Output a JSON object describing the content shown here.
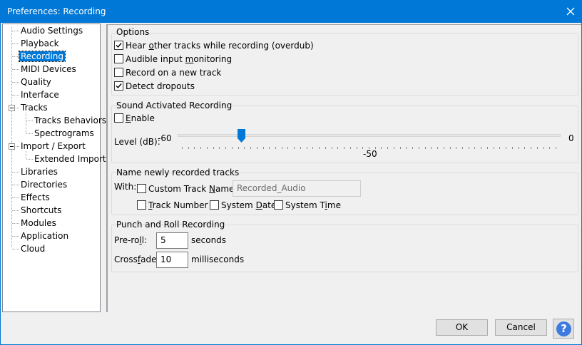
{
  "window": {
    "title": "Preferences: Recording"
  },
  "tree": {
    "items": [
      {
        "label": "Audio Settings"
      },
      {
        "label": "Playback"
      },
      {
        "label": "Recording"
      },
      {
        "label": "MIDI Devices"
      },
      {
        "label": "Quality"
      },
      {
        "label": "Interface"
      },
      {
        "label": "Tracks"
      },
      {
        "label": "Tracks Behaviors"
      },
      {
        "label": "Spectrograms"
      },
      {
        "label": "Import / Export"
      },
      {
        "label": "Extended Import"
      },
      {
        "label": "Libraries"
      },
      {
        "label": "Directories"
      },
      {
        "label": "Effects"
      },
      {
        "label": "Shortcuts"
      },
      {
        "label": "Modules"
      },
      {
        "label": "Application"
      },
      {
        "label": "Cloud"
      }
    ],
    "selected": "Recording"
  },
  "options": {
    "title": "Options",
    "overdub": {
      "pre": "Hear ",
      "u": "o",
      "post": "ther tracks while recording (overdub)",
      "checked": true
    },
    "monitoring": {
      "pre": "Audible input ",
      "u": "m",
      "post": "onitoring",
      "checked": false
    },
    "new_track": {
      "pre": "Record on a new track",
      "checked": false
    },
    "dropouts": {
      "pre": "Detect dropouts",
      "checked": true
    }
  },
  "sound_activated": {
    "title": "Sound Activated Recording",
    "enable": {
      "u": "E",
      "post": "nable",
      "checked": false
    },
    "level_label": "Level (dB):",
    "level_min": "-60",
    "level_max": "0",
    "level_value": "-50",
    "level_fraction": 0.1667
  },
  "naming": {
    "title": "Name newly recorded tracks",
    "with_label": "With:",
    "custom_name": {
      "pre": "Custom Track ",
      "u": "N",
      "post": "ame",
      "checked": false
    },
    "custom_name_value": "Recorded_Audio",
    "track_number": {
      "u": "T",
      "post": "rack Number",
      "checked": false
    },
    "system_date": {
      "pre": "System ",
      "u": "D",
      "post": "ate",
      "checked": false
    },
    "system_time": {
      "pre": "System T",
      "u": "i",
      "post": "me",
      "checked": false
    }
  },
  "punch_roll": {
    "title": "Punch and Roll Recording",
    "preroll_label": {
      "pre": "Pre-ro",
      "u": "l",
      "post": "l:"
    },
    "preroll_value": "5",
    "preroll_unit": "seconds",
    "crossfade_label": {
      "pre": "Cross",
      "u": "f",
      "post": "ade:"
    },
    "crossfade_value": "10",
    "crossfade_unit": "milliseconds"
  },
  "buttons": {
    "ok": "OK",
    "cancel": "Cancel",
    "help": "?"
  },
  "colors": {
    "accent": "#0078d7",
    "help_blue": "#3d7be0"
  }
}
